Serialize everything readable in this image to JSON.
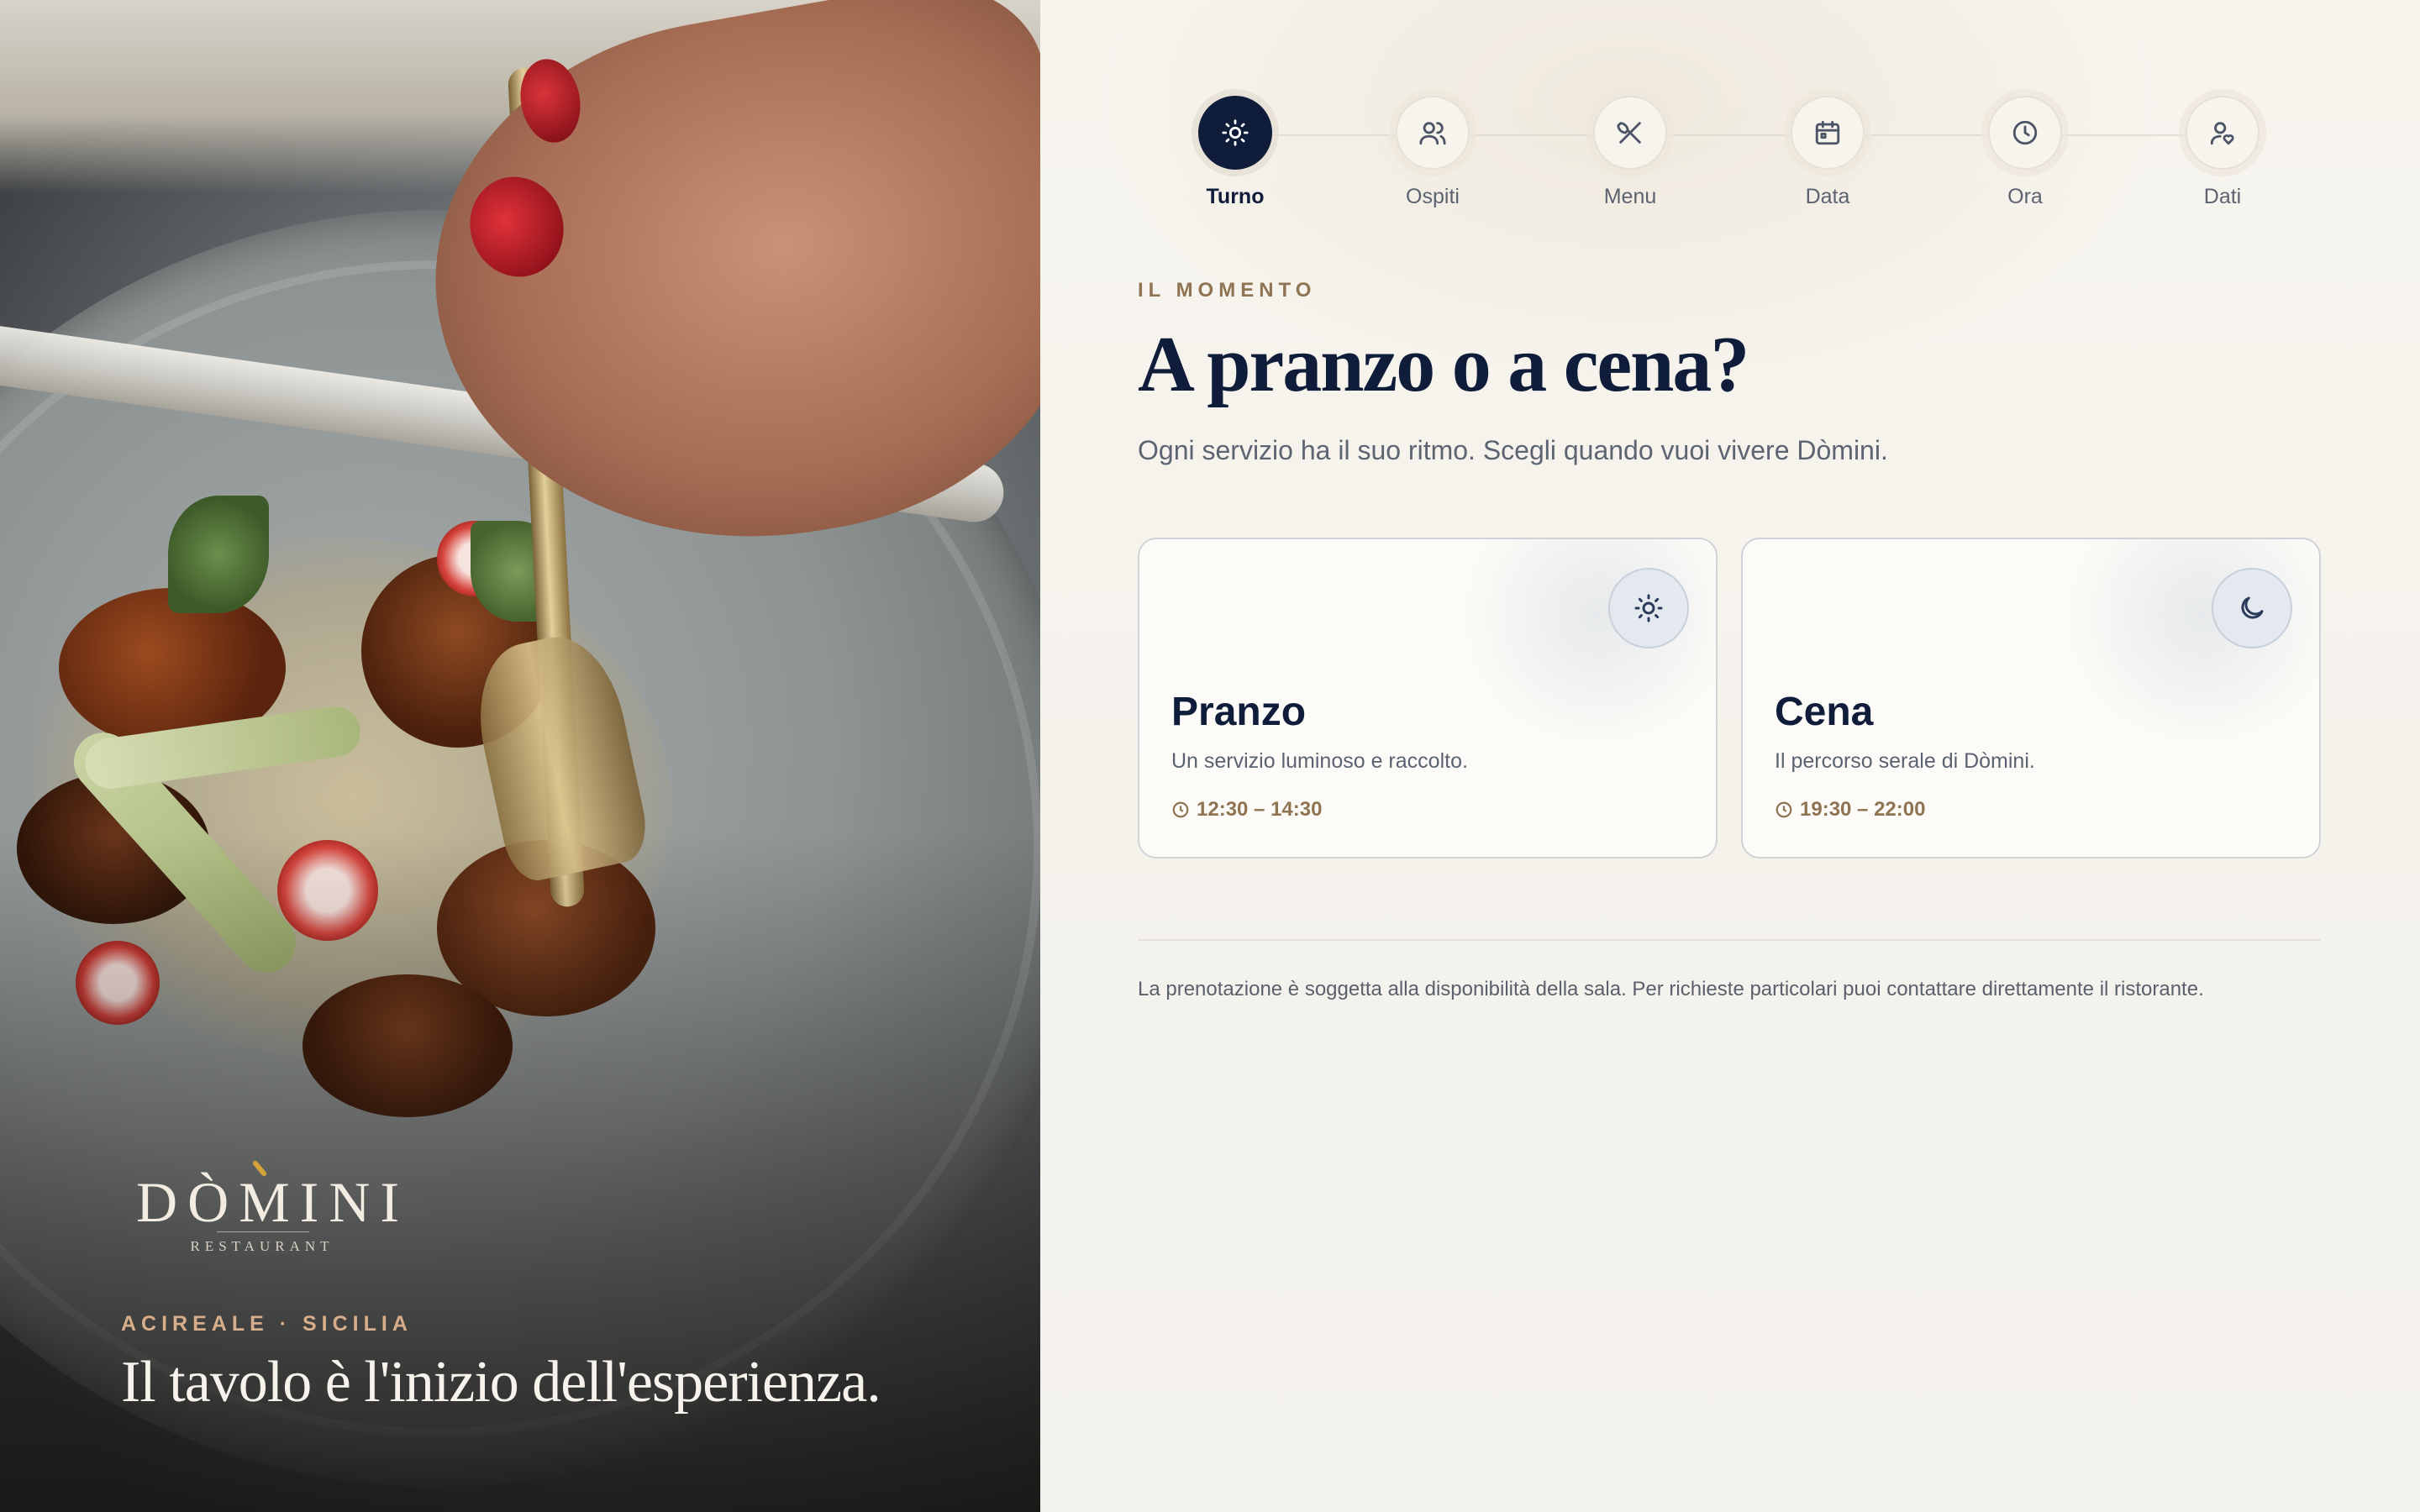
{
  "hero": {
    "logo_word": "DÒMINI",
    "logo_sub": "RESTAURANT",
    "kicker": "ACIREALE · SICILIA",
    "title": "Il tavolo è l'inizio dell'esperienza."
  },
  "stepper": {
    "steps": [
      {
        "label": "Turno",
        "icon": "sun-icon",
        "active": true
      },
      {
        "label": "Ospiti",
        "icon": "users-icon",
        "active": false
      },
      {
        "label": "Menu",
        "icon": "utensils-icon",
        "active": false
      },
      {
        "label": "Data",
        "icon": "calendar-icon",
        "active": false
      },
      {
        "label": "Ora",
        "icon": "clock-icon",
        "active": false
      },
      {
        "label": "Dati",
        "icon": "user-heart-icon",
        "active": false
      }
    ]
  },
  "main": {
    "kicker": "IL MOMENTO",
    "title": "A pranzo o a cena?",
    "subtitle": "Ogni servizio ha il suo ritmo. Scegli quando vuoi vivere Dòmini.",
    "options": [
      {
        "title": "Pranzo",
        "description": "Un servizio luminoso e raccolto.",
        "time": "12:30 – 14:30",
        "icon": "sun-icon"
      },
      {
        "title": "Cena",
        "description": "Il percorso serale di Dòmini.",
        "time": "19:30 – 22:00",
        "icon": "moon-icon"
      }
    ],
    "note": "La prenotazione è soggetta alla disponibilità della sala. Per richieste particolari puoi contattare direttamente il ristorante."
  },
  "colors": {
    "navy": "#0f1d3a",
    "accent_brown": "#8e7452",
    "hero_kicker": "#d7ad8a",
    "logo_accent": "#d4a23a"
  }
}
